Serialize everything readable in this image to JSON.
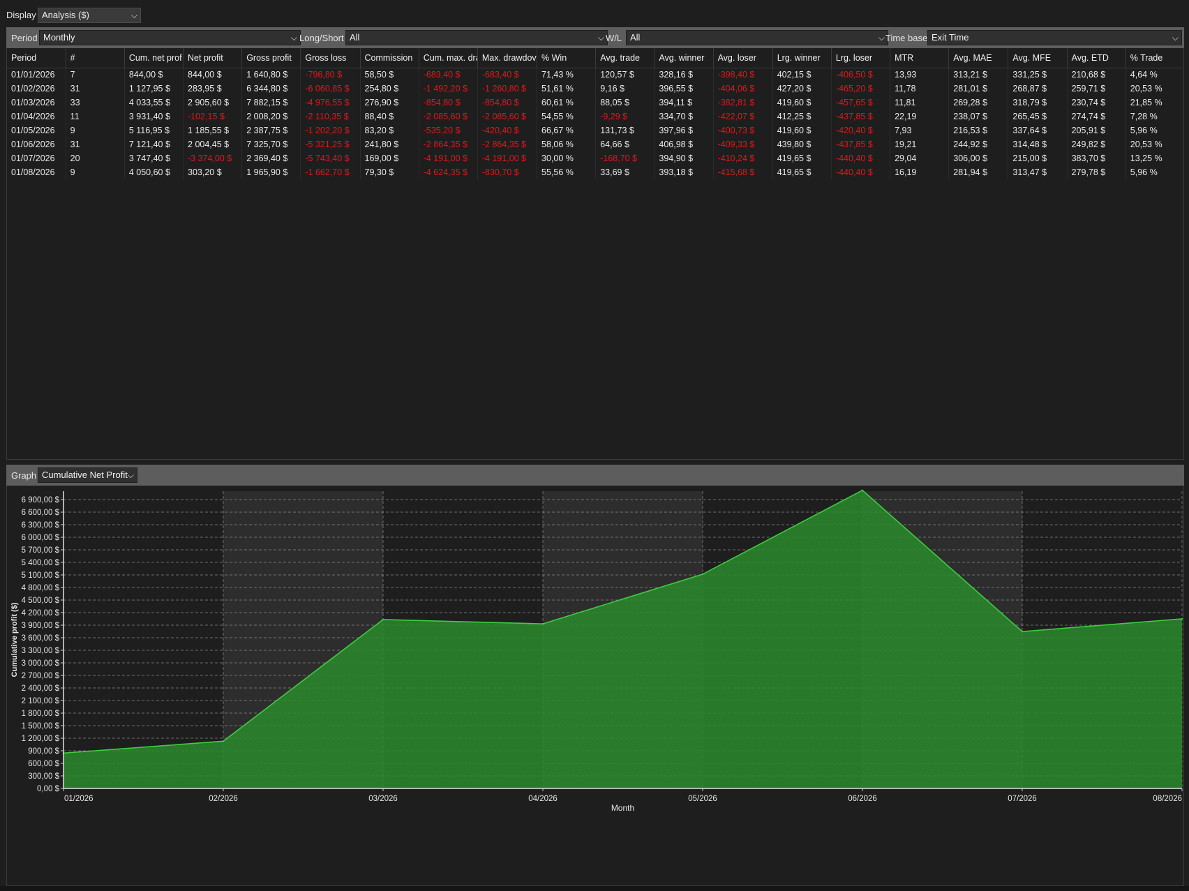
{
  "display": {
    "label": "Display",
    "value": "Analysis ($)"
  },
  "filters": {
    "period": {
      "label": "Period",
      "value": "Monthly"
    },
    "long_short": {
      "label": "Long/Short",
      "value": "All"
    },
    "wl": {
      "label": "W/L",
      "value": "All"
    },
    "time_base": {
      "label": "Time base",
      "value": "Exit Time"
    }
  },
  "table": {
    "columns": [
      "Period",
      "#",
      "Cum. net prof",
      "Net profit",
      "Gross profit",
      "Gross loss",
      "Commission",
      "Cum. max. dra",
      "Max. drawdov",
      "% Win",
      "Avg. trade",
      "Avg. winner",
      "Avg. loser",
      "Lrg. winner",
      "Lrg. loser",
      "MTR",
      "Avg. MAE",
      "Avg. MFE",
      "Avg. ETD",
      "% Trade"
    ],
    "rows": [
      [
        "01/01/2026",
        "7",
        "844,00 $",
        "844,00 $",
        "1 640,80 $",
        "-796,80 $",
        "58,50 $",
        "-683,40 $",
        "-683,40 $",
        "71,43 %",
        "120,57 $",
        "328,16 $",
        "-398,40 $",
        "402,15 $",
        "-406,50 $",
        "13,93",
        "313,21 $",
        "331,25 $",
        "210,68 $",
        "4,64 %"
      ],
      [
        "01/02/2026",
        "31",
        "1 127,95 $",
        "283,95 $",
        "6 344,80 $",
        "-6 060,85 $",
        "254,80 $",
        "-1 492,20 $",
        "-1 260,80 $",
        "51,61 %",
        "9,16 $",
        "396,55 $",
        "-404,06 $",
        "427,20 $",
        "-465,20 $",
        "11,78",
        "281,01 $",
        "268,87 $",
        "259,71 $",
        "20,53 %"
      ],
      [
        "01/03/2026",
        "33",
        "4 033,55 $",
        "2 905,60 $",
        "7 882,15 $",
        "-4 976,55 $",
        "276,90 $",
        "-854,80 $",
        "-854,80 $",
        "60,61 %",
        "88,05 $",
        "394,11 $",
        "-382,81 $",
        "419,60 $",
        "-457,65 $",
        "11,81",
        "269,28 $",
        "318,79 $",
        "230,74 $",
        "21,85 %"
      ],
      [
        "01/04/2026",
        "11",
        "3 931,40 $",
        "-102,15 $",
        "2 008,20 $",
        "-2 110,35 $",
        "88,40 $",
        "-2 085,60 $",
        "-2 085,60 $",
        "54,55 %",
        "-9,29 $",
        "334,70 $",
        "-422,07 $",
        "412,25 $",
        "-437,85 $",
        "22,19",
        "238,07 $",
        "265,45 $",
        "274,74 $",
        "7,28 %"
      ],
      [
        "01/05/2026",
        "9",
        "5 116,95 $",
        "1 185,55 $",
        "2 387,75 $",
        "-1 202,20 $",
        "83,20 $",
        "-535,20 $",
        "-420,40 $",
        "66,67 %",
        "131,73 $",
        "397,96 $",
        "-400,73 $",
        "419,60 $",
        "-420,40 $",
        "7,93",
        "216,53 $",
        "337,64 $",
        "205,91 $",
        "5,96 %"
      ],
      [
        "01/06/2026",
        "31",
        "7 121,40 $",
        "2 004,45 $",
        "7 325,70 $",
        "-5 321,25 $",
        "241,80 $",
        "-2 864,35 $",
        "-2 864,35 $",
        "58,06 %",
        "64,66 $",
        "406,98 $",
        "-409,33 $",
        "439,80 $",
        "-437,85 $",
        "19,21",
        "244,92 $",
        "314,48 $",
        "249,82 $",
        "20,53 %"
      ],
      [
        "01/07/2026",
        "20",
        "3 747,40 $",
        "-3 374,00 $",
        "2 369,40 $",
        "-5 743,40 $",
        "169,00 $",
        "-4 191,00 $",
        "-4 191,00 $",
        "30,00 %",
        "-168,70 $",
        "394,90 $",
        "-410,24 $",
        "419,65 $",
        "-440,40 $",
        "29,04",
        "306,00 $",
        "215,00 $",
        "383,70 $",
        "13,25 %"
      ],
      [
        "01/08/2026",
        "9",
        "4 050,60 $",
        "303,20 $",
        "1 965,90 $",
        "-1 662,70 $",
        "79,30 $",
        "-4 624,35 $",
        "-830,70 $",
        "55,56 %",
        "33,69 $",
        "393,18 $",
        "-415,68 $",
        "419,65 $",
        "-440,40 $",
        "16,19",
        "281,94 $",
        "313,47 $",
        "279,78 $",
        "5,96 %"
      ]
    ]
  },
  "graph": {
    "label": "Graph",
    "value": "Cumulative Net Profit"
  },
  "chart_data": {
    "type": "area",
    "xlabel": "Month",
    "ylabel": "Cumulative profit ($)",
    "categories": [
      "01/2026",
      "02/2026",
      "03/2026",
      "04/2026",
      "05/2026",
      "06/2026",
      "07/2026",
      "08/2026"
    ],
    "values": [
      844.0,
      1127.95,
      4033.55,
      3931.4,
      5116.95,
      7121.4,
      3747.4,
      4050.6
    ],
    "ylim": [
      0,
      7100
    ],
    "yticks": [
      0,
      300,
      600,
      900,
      1200,
      1500,
      1800,
      2100,
      2400,
      2700,
      3000,
      3300,
      3600,
      3900,
      4200,
      4500,
      4800,
      5100,
      5400,
      5700,
      6000,
      6300,
      6600,
      6900
    ],
    "ytick_labels": [
      "0,00 $",
      "300,00 $",
      "600,00 $",
      "900,00 $",
      "1 200,00 $",
      "1 500,00 $",
      "1 800,00 $",
      "2 100,00 $",
      "2 400,00 $",
      "2 700,00 $",
      "3 000,00 $",
      "3 300,00 $",
      "3 600,00 $",
      "3 900,00 $",
      "4 200,00 $",
      "4 500,00 $",
      "4 800,00 $",
      "5 100,00 $",
      "5 400,00 $",
      "5 700,00 $",
      "6 000,00 $",
      "6 300,00 $",
      "6 600,00 $",
      "6 900,00 $"
    ],
    "grid": true,
    "colors": {
      "fill": "#2a8a2d",
      "line": "#3ccd3f",
      "band": "#2d2d2d",
      "grid": "#8a8a8a"
    }
  }
}
